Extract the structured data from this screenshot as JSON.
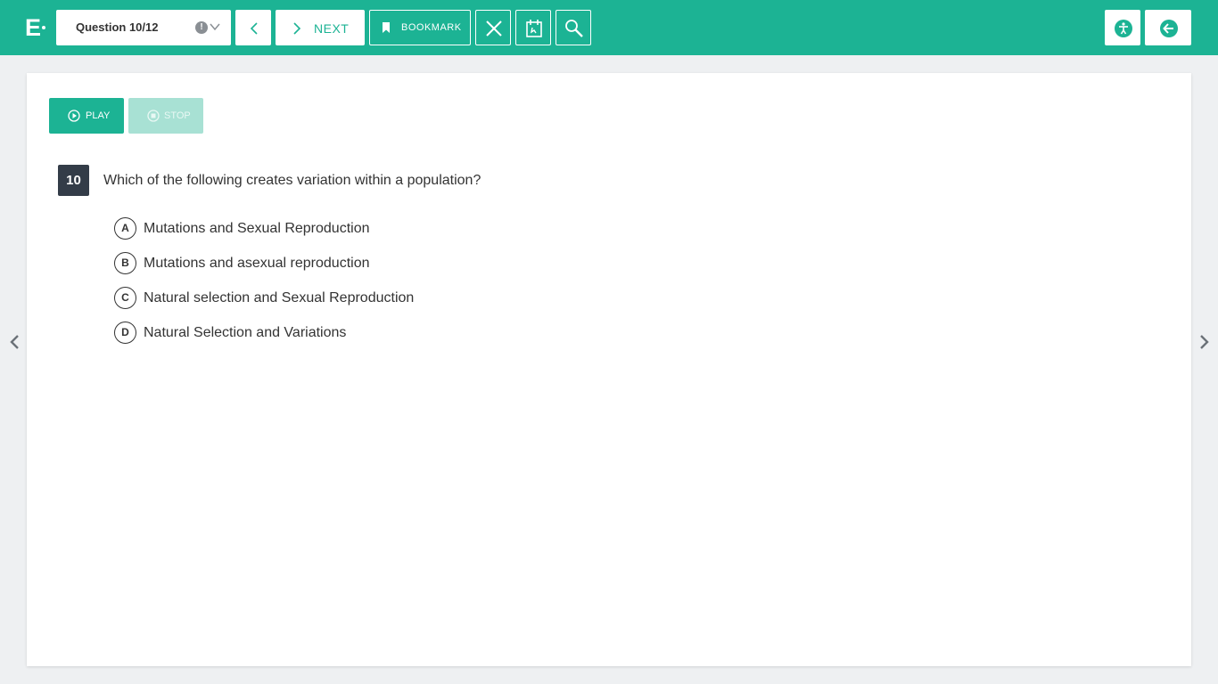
{
  "header": {
    "logo_letter": "E",
    "question_selector": "Question 10/12",
    "warning_glyph": "!",
    "next_label": "NEXT",
    "bookmark_label": "BOOKMARK",
    "icons": [
      "chevron-left-icon",
      "chevron-right-icon",
      "bookmark-icon",
      "close-icon",
      "calendar-icon",
      "magnifier-icon",
      "accessibility-icon",
      "exit-icon"
    ]
  },
  "audio": {
    "play_label": "PLAY",
    "stop_label": "STOP"
  },
  "question": {
    "number": "10",
    "text": "Which of the following creates variation within a population?",
    "options": [
      {
        "letter": "A",
        "text": "Mutations and Sexual Reproduction"
      },
      {
        "letter": "B",
        "text": "Mutations and asexual reproduction"
      },
      {
        "letter": "C",
        "text": "Natural selection and Sexual Reproduction"
      },
      {
        "letter": "D",
        "text": "Natural Selection and Variations"
      }
    ]
  },
  "colors": {
    "accent": "#1cb394",
    "accent_disabled": "#a8e1d4",
    "number_badge": "#333c48",
    "page_bg": "#eef0f2"
  }
}
